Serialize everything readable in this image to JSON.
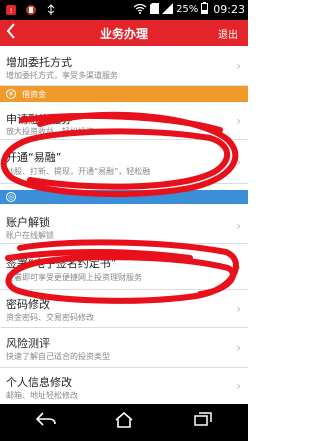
{
  "status_bar": {
    "time": "09:23",
    "battery": "25%",
    "icons": [
      "notification-icon",
      "app-icon",
      "usb-icon",
      "wifi-icon",
      "sd-card-icon",
      "signal-icon",
      "battery-icon"
    ]
  },
  "nav": {
    "title": "业务办理",
    "exit": "退出",
    "back_icon": "back-arrow-icon"
  },
  "items": [
    {
      "title": "增加委托方式",
      "subtitle": "增加委托方式，享受多渠道服务"
    },
    {
      "title": "申请融资融券",
      "subtitle": "放大投资收益，轻松投资"
    },
    {
      "title": "开通“易融”",
      "subtitle": "炒股、打新、提现，开通“易融”，轻松融"
    },
    {
      "title": "账户解锁",
      "subtitle": "账户在线解锁"
    },
    {
      "title": "签署“电子签名约定书”",
      "subtitle": "签署即可享受更便捷网上投资理财服务"
    },
    {
      "title": "密码修改",
      "subtitle": "资金密码、交易密码修改"
    },
    {
      "title": "风险测评",
      "subtitle": "快速了解自己适合的投资类型"
    },
    {
      "title": "个人信息修改",
      "subtitle": "邮箱、地址轻松修改"
    }
  ],
  "sections": [
    {
      "label": "借资金",
      "icon": "money-icon",
      "color": "#f09a2b"
    },
    {
      "label": "",
      "icon": "account-icon",
      "color": "#3a8fd8"
    }
  ],
  "bottom_nav": {
    "back": "back-icon",
    "home": "home-icon",
    "recent": "recent-apps-icon"
  }
}
